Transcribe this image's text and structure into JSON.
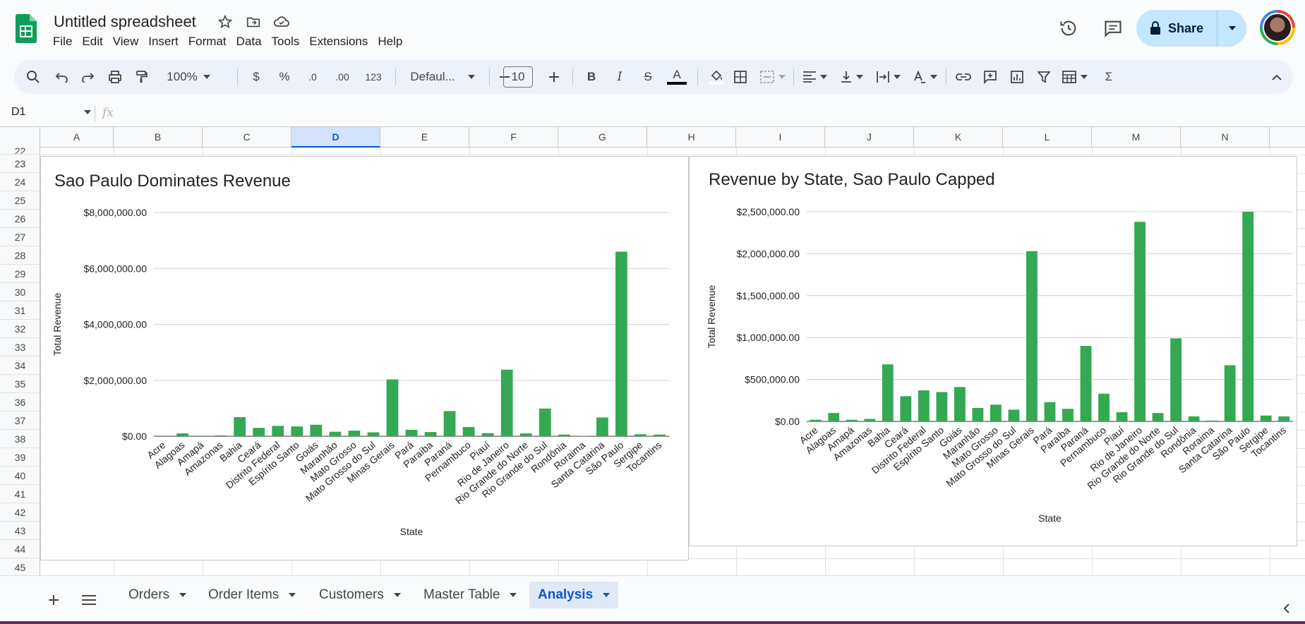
{
  "app": {
    "doc_title": "Untitled spreadsheet",
    "menu": [
      "File",
      "Edit",
      "View",
      "Insert",
      "Format",
      "Data",
      "Tools",
      "Extensions",
      "Help"
    ],
    "share_label": "Share"
  },
  "toolbar": {
    "zoom": "100%",
    "currency": "$",
    "percent": "%",
    "dec_decrease": ".0",
    "dec_increase": ".00",
    "number_format": "123",
    "font": "Defaul...",
    "font_size": "10",
    "bold": "B",
    "italic": "I",
    "strike": "S",
    "text_color": "A",
    "sum": "Σ"
  },
  "formula_bar": {
    "cell_ref": "D1",
    "fx": "fx",
    "value": ""
  },
  "columns": [
    "A",
    "B",
    "C",
    "D",
    "E",
    "F",
    "G",
    "H",
    "I",
    "J",
    "K",
    "L",
    "M",
    "N"
  ],
  "selected_column": "D",
  "rows": [
    "22",
    "23",
    "24",
    "25",
    "26",
    "27",
    "28",
    "29",
    "30",
    "31",
    "32",
    "33",
    "34",
    "35",
    "36",
    "37",
    "38",
    "39",
    "40",
    "41",
    "42",
    "43",
    "44",
    "45"
  ],
  "sheet_tabs": [
    {
      "label": "Orders",
      "active": false
    },
    {
      "label": "Order Items",
      "active": false
    },
    {
      "label": "Customers",
      "active": false
    },
    {
      "label": "Master Table",
      "active": false
    },
    {
      "label": "Analysis",
      "active": true
    }
  ],
  "colors": {
    "bar": "#34a853",
    "accent": "#0b57d0",
    "share_bg": "#c2e7ff"
  },
  "chart_data": [
    {
      "type": "bar",
      "title": "Sao Paulo Dominates Revenue",
      "xlabel": "State",
      "ylabel": "Total Revenue",
      "ylim": [
        0,
        8000000
      ],
      "yticks": [
        "$0.00",
        "$2,000,000.00",
        "$4,000,000.00",
        "$6,000,000.00",
        "$8,000,000.00"
      ],
      "grid": true,
      "categories": [
        "Acre",
        "Alagoas",
        "Amapá",
        "Amazonas",
        "Bahia",
        "Ceará",
        "Distrito Federal",
        "Espírito Santo",
        "Goiás",
        "Maranhão",
        "Mato Grosso",
        "Mato Grosso do Sul",
        "Minas Gerais",
        "Pará",
        "Paraíba",
        "Paraná",
        "Pernambuco",
        "Piauí",
        "Rio de Janeiro",
        "Rio Grande do Norte",
        "Rio Grande do Sul",
        "Rondônia",
        "Roraima",
        "Santa Catarina",
        "São Paulo",
        "Sergipe",
        "Tocantins"
      ],
      "values": [
        20000,
        100000,
        20000,
        30000,
        680000,
        300000,
        370000,
        350000,
        410000,
        160000,
        200000,
        140000,
        2030000,
        230000,
        150000,
        900000,
        330000,
        110000,
        2380000,
        100000,
        990000,
        60000,
        10000,
        670000,
        6600000,
        70000,
        60000
      ]
    },
    {
      "type": "bar",
      "title": "Revenue by State, Sao Paulo Capped",
      "xlabel": "State",
      "ylabel": "Total Revenue",
      "ylim": [
        0,
        2500000
      ],
      "yticks": [
        "$0.00",
        "$500,000.00",
        "$1,000,000.00",
        "$1,500,000.00",
        "$2,000,000.00",
        "$2,500,000.00"
      ],
      "grid": true,
      "categories": [
        "Acre",
        "Alagoas",
        "Amapá",
        "Amazonas",
        "Bahia",
        "Ceará",
        "Distrito Federal",
        "Espírito Santo",
        "Goiás",
        "Maranhão",
        "Mato Grosso",
        "Mato Grosso do Sul",
        "Minas Gerais",
        "Pará",
        "Paraíba",
        "Paraná",
        "Pernambuco",
        "Piauí",
        "Rio de Janeiro",
        "Rio Grande do Norte",
        "Rio Grande do Sul",
        "Rondônia",
        "Roraima",
        "Santa Catarina",
        "São Paulo",
        "Sergipe",
        "Tocantins"
      ],
      "values": [
        20000,
        100000,
        20000,
        30000,
        680000,
        300000,
        370000,
        350000,
        410000,
        160000,
        200000,
        140000,
        2030000,
        230000,
        150000,
        900000,
        330000,
        110000,
        2380000,
        100000,
        990000,
        60000,
        10000,
        670000,
        2500000,
        70000,
        60000
      ]
    }
  ]
}
